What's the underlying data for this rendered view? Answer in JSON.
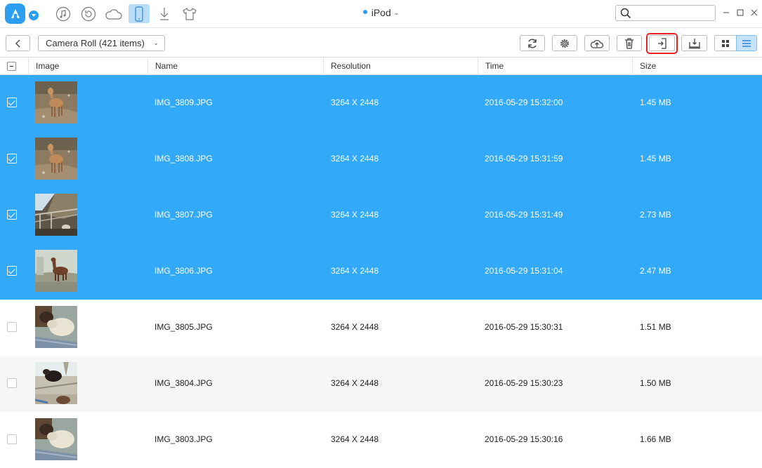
{
  "topbar": {
    "device_name": "iPod",
    "nav": [
      {
        "name": "music-icon"
      },
      {
        "name": "restore-icon"
      },
      {
        "name": "cloud-icon"
      },
      {
        "name": "phone-icon",
        "active": true
      },
      {
        "name": "download-icon"
      },
      {
        "name": "tshirt-icon"
      }
    ],
    "search": {
      "placeholder": ""
    }
  },
  "toolbar": {
    "album_label": "Camera Roll (421 items)",
    "buttons": [
      "refresh-icon",
      "settings-icon",
      "upload-icon",
      "delete-icon",
      "send-to-device-icon",
      "export-to-pc-icon",
      "grid-view-icon",
      "list-view-icon"
    ],
    "highlight_color": "#e52222"
  },
  "table": {
    "headers": {
      "image": "Image",
      "name": "Name",
      "resolution": "Resolution",
      "time": "Time",
      "size": "Size"
    },
    "rows": [
      {
        "name": "IMG_3809.JPG",
        "resolution": "3264 X 2448",
        "time": "2016-05-29 15:32:00",
        "size": "1.45 MB",
        "selected": true,
        "thumb": "deer"
      },
      {
        "name": "IMG_3808.JPG",
        "resolution": "3264 X 2448",
        "time": "2016-05-29 15:31:59",
        "size": "1.45 MB",
        "selected": true,
        "thumb": "deer"
      },
      {
        "name": "IMG_3807.JPG",
        "resolution": "3264 X 2448",
        "time": "2016-05-29 15:31:49",
        "size": "2.73 MB",
        "selected": true,
        "thumb": "pen"
      },
      {
        "name": "IMG_3806.JPG",
        "resolution": "3264 X 2448",
        "time": "2016-05-29 15:31:04",
        "size": "2.47 MB",
        "selected": true,
        "thumb": "alpaca"
      },
      {
        "name": "IMG_3805.JPG",
        "resolution": "3264 X 2448",
        "time": "2016-05-29 15:30:31",
        "size": "1.51 MB",
        "selected": false,
        "thumb": "sheep"
      },
      {
        "name": "IMG_3804.JPG",
        "resolution": "3264 X 2448",
        "time": "2016-05-29 15:30:23",
        "size": "1.50 MB",
        "selected": false,
        "thumb": "goat"
      },
      {
        "name": "IMG_3803.JPG",
        "resolution": "3264 X 2448",
        "time": "2016-05-29 15:30:16",
        "size": "1.66 MB",
        "selected": false,
        "thumb": "sheep"
      }
    ]
  },
  "colors": {
    "accent": "#2d9ff2",
    "selected_row": "#32aaf9"
  }
}
